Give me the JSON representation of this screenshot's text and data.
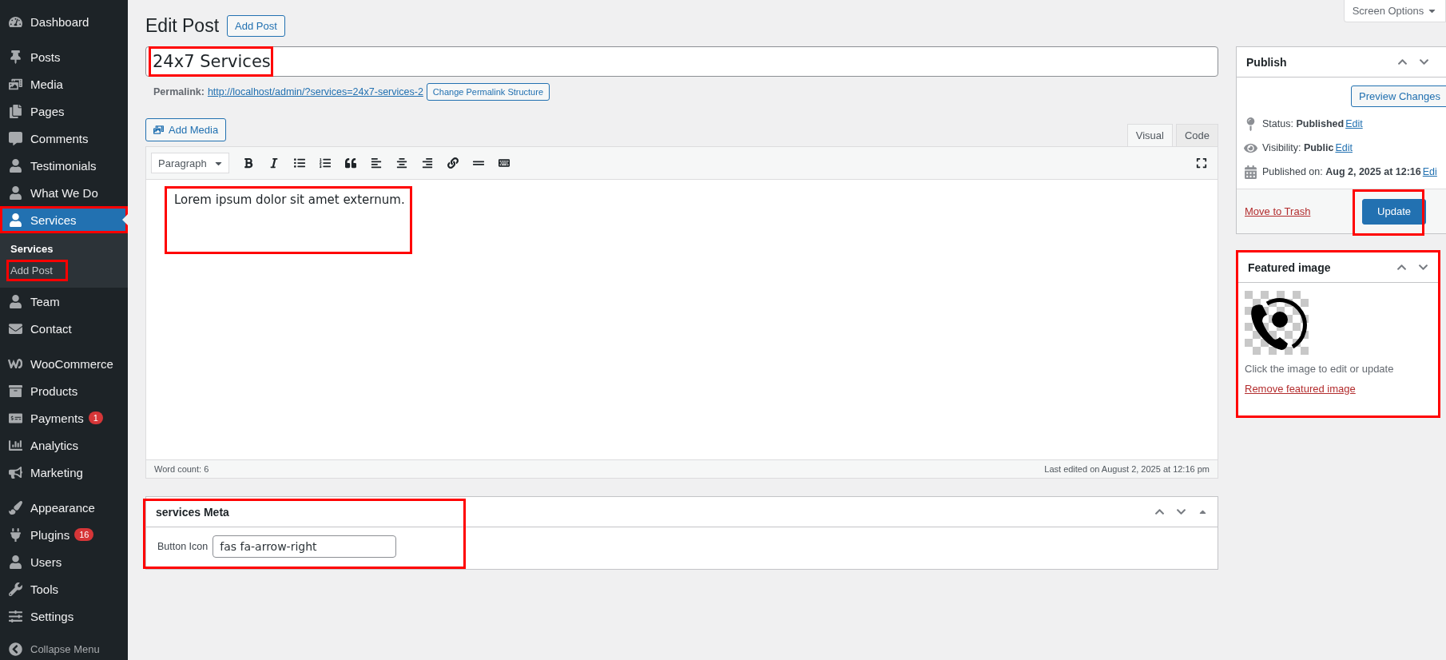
{
  "sidebar": {
    "groups": [
      [
        {
          "label": "Dashboard",
          "selected": false,
          "highlighted": false
        }
      ],
      [
        {
          "label": "Posts",
          "selected": false,
          "highlighted": false
        },
        {
          "label": "Media",
          "selected": false,
          "highlighted": false
        },
        {
          "label": "Pages",
          "selected": false,
          "highlighted": false
        },
        {
          "label": "Comments",
          "selected": false,
          "highlighted": false
        },
        {
          "label": "Testimonials",
          "selected": false,
          "highlighted": false
        },
        {
          "label": "What We Do",
          "selected": false,
          "highlighted": false
        },
        {
          "label": "Services",
          "selected": true,
          "highlighted": true,
          "children": [
            {
              "label": "Services",
              "selected": true,
              "highlighted": false
            },
            {
              "label": "Add Post",
              "selected": false,
              "highlighted": true
            }
          ]
        },
        {
          "label": "Team",
          "selected": false,
          "highlighted": false
        },
        {
          "label": "Contact",
          "selected": false,
          "highlighted": false
        }
      ],
      [
        {
          "label": "WooCommerce",
          "selected": false,
          "highlighted": false
        },
        {
          "label": "Products",
          "selected": false,
          "highlighted": false
        },
        {
          "label": "Payments",
          "selected": false,
          "highlighted": false,
          "badge": "1"
        },
        {
          "label": "Analytics",
          "selected": false,
          "highlighted": false
        },
        {
          "label": "Marketing",
          "selected": false,
          "highlighted": false
        }
      ],
      [
        {
          "label": "Appearance",
          "selected": false,
          "highlighted": false
        },
        {
          "label": "Plugins",
          "selected": false,
          "highlighted": false,
          "badge": "16"
        },
        {
          "label": "Users",
          "selected": false,
          "highlighted": false
        },
        {
          "label": "Tools",
          "selected": false,
          "highlighted": false
        },
        {
          "label": "Settings",
          "selected": false,
          "highlighted": false
        }
      ]
    ],
    "collapse": "Collapse Menu"
  },
  "header": {
    "title": "Edit Post",
    "add_button": "Add Post",
    "screen_options": "Screen Options"
  },
  "post": {
    "title": "24x7 Services",
    "title_highlighted": true,
    "permalink_label": "Permalink:",
    "permalink_url": "http://localhost/admin/?services=24x7-services-2",
    "permalink_button": "Change Permalink Structure"
  },
  "editor": {
    "add_media": "Add Media",
    "tabs": [
      {
        "label": "Visual",
        "selected": true
      },
      {
        "label": "Code",
        "selected": false
      }
    ],
    "format": "Paragraph",
    "content": "Lorem ipsum dolor sit amet externum.",
    "content_highlighted": true,
    "word_count": "Word count: 6",
    "last_edited": "Last edited on August 2, 2025 at 12:16 pm"
  },
  "meta_box": {
    "title": "services Meta",
    "highlighted": true,
    "field_label": "Button Icon",
    "field_value": "fas fa-arrow-right"
  },
  "publish": {
    "title": "Publish",
    "preview": "Preview Changes",
    "rows": [
      {
        "label": "Status:",
        "value": "Published",
        "link": "Edit"
      },
      {
        "label": "Visibility:",
        "value": "Public",
        "link": "Edit"
      },
      {
        "label": "Published on:",
        "value": "Aug 2, 2025 at 12:16",
        "link": "Edi"
      }
    ],
    "trash": "Move to Trash",
    "update": "Update",
    "update_highlighted": true
  },
  "featured": {
    "title": "Featured image",
    "highlighted": true,
    "hint": "Click the image to edit or update",
    "remove": "Remove featured image"
  }
}
